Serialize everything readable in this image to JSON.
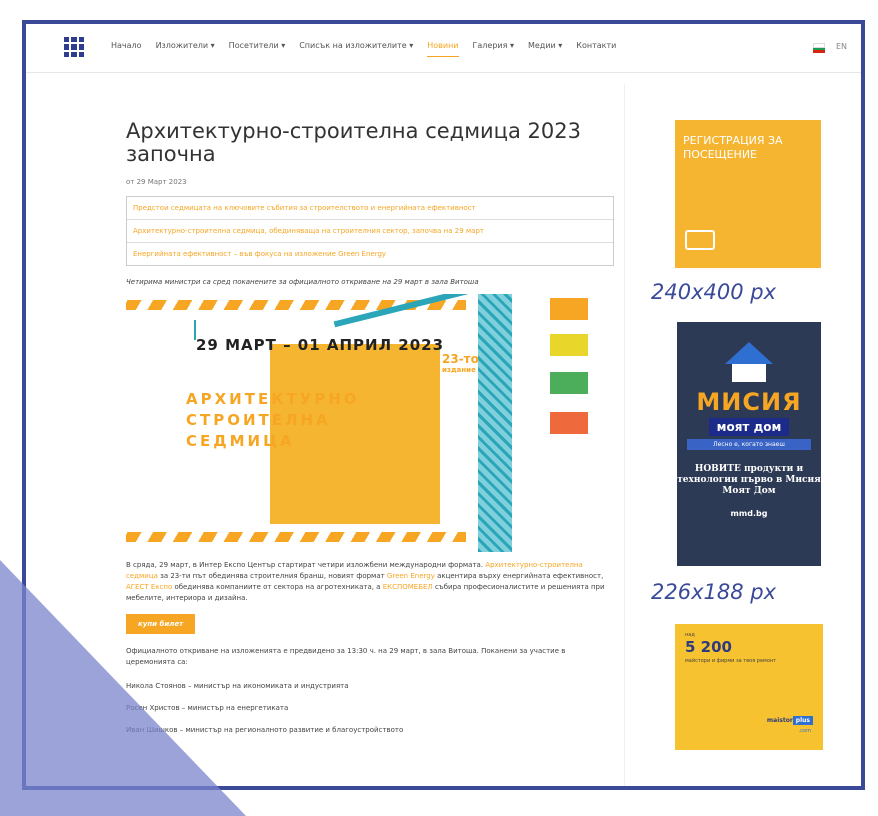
{
  "nav": {
    "items": [
      "Начало",
      "Изложители ▾",
      "Посетители ▾",
      "Списък на изложителите ▾",
      "Новини",
      "Галерия ▾",
      "Медии ▾",
      "Контакти"
    ],
    "active_index": 4,
    "lang": "EN"
  },
  "article": {
    "title": "Архитектурно-строителна седмица 2023 започна",
    "date": "от 29 Март 2023",
    "related": [
      "Предстои седмицата на ключовите събития за строителството и енергийната ефективност",
      "Архитектурно-строителна седмица, обединяваща на строителния сектор, започва на 29 март",
      "Енергийната ефективност – във фокуса на изложение Green Energy"
    ],
    "lead": "Четирима министри са сред поканените за официалното откриване на 29 март в зала Витоша",
    "poster": {
      "dates": "29 МАРТ – 01 АПРИЛ 2023",
      "edition": "23-то",
      "edition_sub": "издание",
      "line1": "АРХИТЕКТУРНО",
      "line2": "СТРОИТЕЛНА",
      "line3": "СЕДМИЦА"
    },
    "body_a": "В сряда, 29 март, в Интер Експо Център стартират четири изложбени международни формата. ",
    "body_link1": "Архитектурно-строителна седмица",
    "body_b": " за 23-ти път обединява строителния бранш, новият формат ",
    "body_link2": "Green Energy",
    "body_c": " акцентира върху енергийната ефективност, ",
    "body_link3": "АГЕСТ Експо",
    "body_d": " обединява компаниите от сектора на агротехниката, а ",
    "body_link4": "ЕКСПОМЕБЕЛ",
    "body_e": " събира професионалистите и решенията при мебелите, интериора и дизайна.",
    "ticket_label": "купи билет",
    "p2": "Официалното откриване на изложенията е предвидено за 13:30 ч. на 29 март, в зала Витоша. Поканени за участие в церемонията са:",
    "ministers": [
      "Никола Стоянов – министър на икономиката и индустрията",
      "Росен Христов – министър на енергетиката",
      "Иван Шишков – министър на регионалното развитие и благоустройството"
    ]
  },
  "sidebar": {
    "ad1_text": "РЕГИСТРАЦИЯ ЗА ПОСЕЩЕНИЕ",
    "dim1": "240x400 px",
    "ad2": {
      "brand": "МИСИЯ",
      "brand2": "моят дом",
      "slogan": "Лесно е, когато знаеш",
      "news": "НОВИТЕ продукти и технологии първо в Мисия Моят Дом",
      "url": "mmd.bg"
    },
    "dim2": "226x188 px",
    "ad3": {
      "small": "над",
      "num": "5 200",
      "sub": "майстори и фирми за твоя ремонт",
      "logo": "maistor",
      "logo_plus": "plus",
      "com": ".com"
    }
  }
}
